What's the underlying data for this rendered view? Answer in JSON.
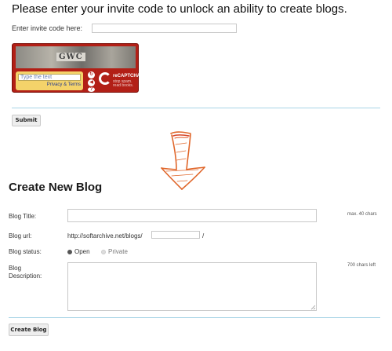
{
  "invite": {
    "heading": "Please enter your invite code to unlock an ability to create blogs.",
    "code_label": "Enter invite code here:",
    "code_value": ""
  },
  "captcha": {
    "image_word": "GWC",
    "input_placeholder": "Type the text",
    "privacy_link": "Privacy & Terms",
    "brand": "reCAPTCHA",
    "tagline_1": "stop spam.",
    "tagline_2": "read books.",
    "controls": [
      "refresh-icon",
      "audio-icon",
      "help-icon"
    ]
  },
  "submit_label": "Submit",
  "arrow_color": "#e0662a",
  "create": {
    "title": "Create New Blog",
    "blog_title_label": "Blog Title:",
    "blog_title_value": "",
    "blog_title_limit": "max. 40 chars",
    "blog_url_label": "Blog url:",
    "blog_url_prefix": "http://softarchive.net/blogs/",
    "blog_url_value": "",
    "blog_url_suffix": "/",
    "status_label": "Blog status:",
    "status_options": [
      "Open",
      "Private"
    ],
    "status_selected": "Open",
    "description_label_1": "Blog",
    "description_label_2": "Description:",
    "description_value": "",
    "description_counter": "700 chars left",
    "create_button": "Create Blog"
  }
}
